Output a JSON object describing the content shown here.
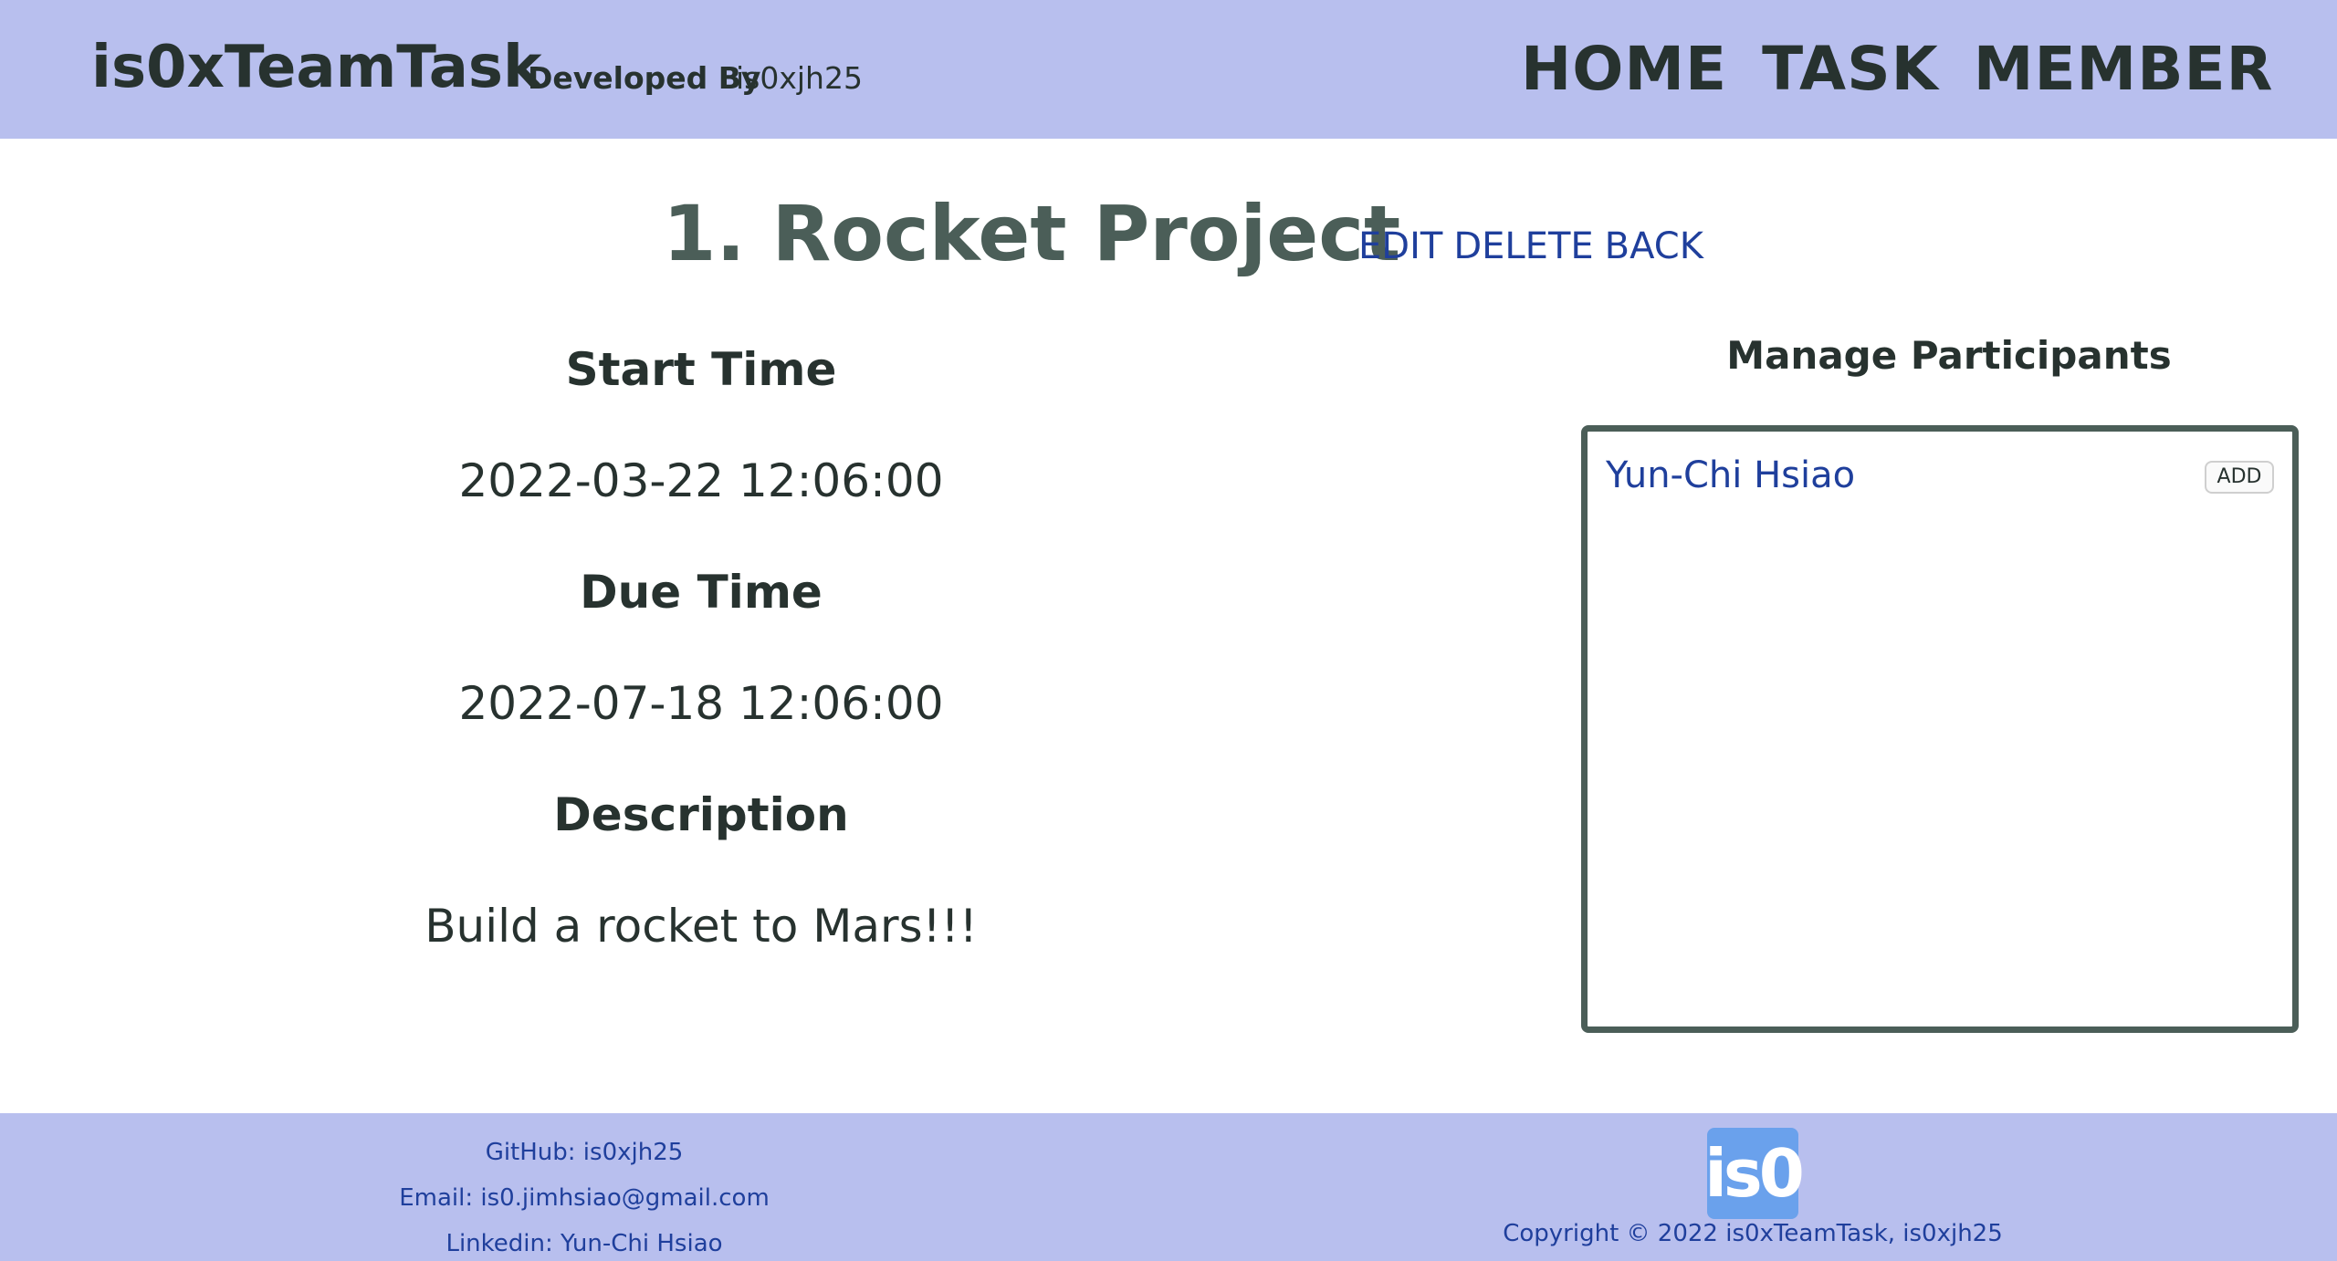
{
  "header": {
    "brand": "is0xTeamTask",
    "developed_by_label": "Developed By",
    "developer": "is0xjh25",
    "nav": {
      "home": "HOME",
      "task": "TASK",
      "member": "MEMBER"
    }
  },
  "task": {
    "title": "1. Rocket Project",
    "actions": {
      "edit": "EDIT",
      "delete": "DELETE",
      "back": "BACK"
    },
    "start_time_label": "Start Time",
    "start_time": "2022-03-22 12:06:00",
    "due_time_label": "Due Time",
    "due_time": "2022-07-18 12:06:00",
    "description_label": "Description",
    "description": "Build a rocket to Mars!!!"
  },
  "participants": {
    "title": "Manage Participants",
    "items": [
      {
        "name": "Yun-Chi Hsiao",
        "action": "ADD"
      }
    ]
  },
  "footer": {
    "github": "GitHub: is0xjh25",
    "email": "Email: is0.jimhsiao@gmail.com",
    "linkedin": "Linkedin: Yun-Chi Hsiao",
    "logo_text": "is0",
    "copyright": "Copyright © 2022 is0xTeamTask, is0xjh25"
  },
  "colors": {
    "header_bg": "#b8bfee",
    "text_dark": "#27322f",
    "title": "#4b5e58",
    "link": "#1f3f9c",
    "logo_bg": "#6aa1ec"
  }
}
